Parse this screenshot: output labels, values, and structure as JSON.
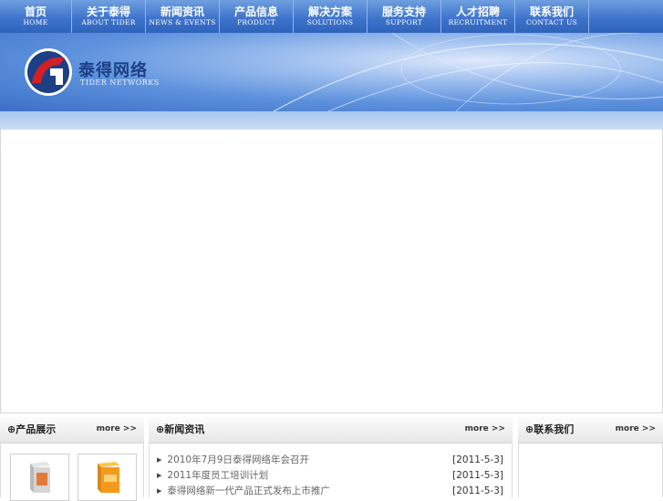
{
  "nav": [
    {
      "zh": "首页",
      "en": "HOME"
    },
    {
      "zh": "关于泰得",
      "en": "ABOUT TIDER"
    },
    {
      "zh": "新闻资讯",
      "en": "NEWS & EVENTS"
    },
    {
      "zh": "产品信息",
      "en": "PRODUCT"
    },
    {
      "zh": "解决方案",
      "en": "SOLUTIONS"
    },
    {
      "zh": "服务支持",
      "en": "SUPPORT"
    },
    {
      "zh": "人才招聘",
      "en": "RECRUITMENT"
    },
    {
      "zh": "联系我们",
      "en": "CONTACT US"
    }
  ],
  "logo": {
    "zh": "泰得网络",
    "en": "TIDER NETWORKS"
  },
  "sections": {
    "left": {
      "title": "⊕产品展示",
      "more": "more >>"
    },
    "middle": {
      "title": "⊕新闻资讯",
      "more": "more >>"
    },
    "right": {
      "title": "⊕联系我们",
      "more": "more >>"
    }
  },
  "news": [
    {
      "title": "2010年7月9日泰得网络年会召开",
      "date": "[2011-5-3]"
    },
    {
      "title": "2011年度员工培训计划",
      "date": "[2011-5-3]"
    },
    {
      "title": "泰得网络新一代产品正式发布上市推广",
      "date": "[2011-5-3]"
    }
  ],
  "colors": {
    "nav_top": "#6f9fe0",
    "nav_bottom": "#2f63bb",
    "logo_red": "#d22027",
    "logo_blue": "#1c3f86"
  }
}
